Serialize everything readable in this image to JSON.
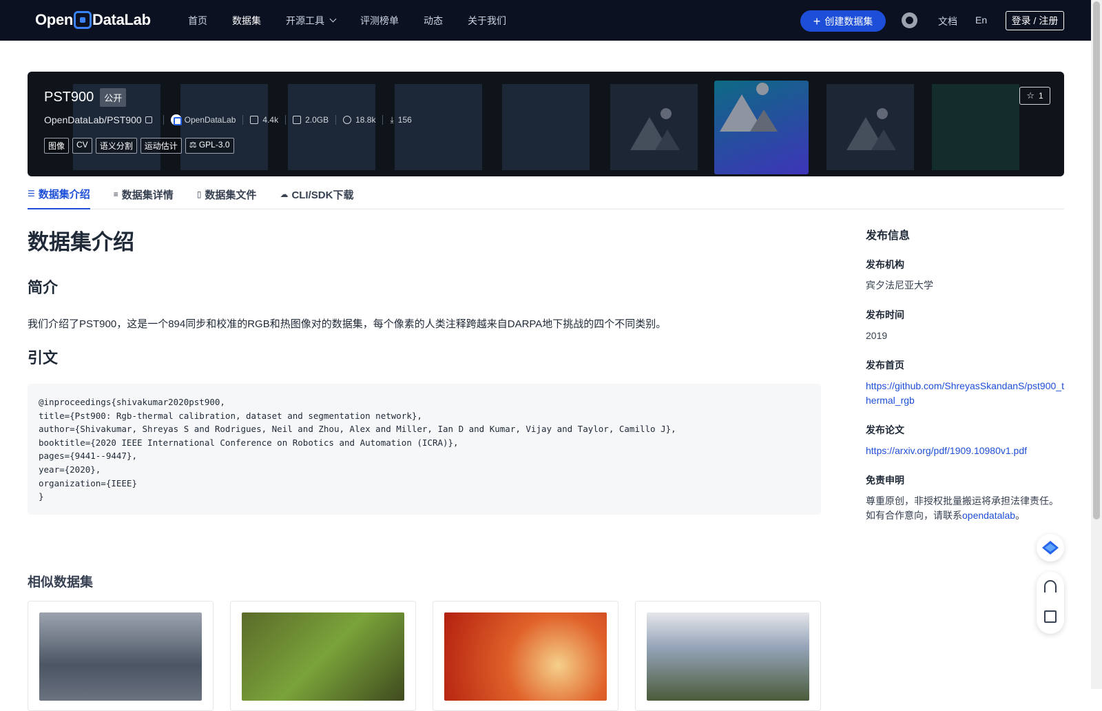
{
  "brand": {
    "name_part1": "Open",
    "name_part2": "DataLab"
  },
  "nav": {
    "home": "首页",
    "datasets": "数据集",
    "tools": "开源工具",
    "leaderboard": "评测榜单",
    "news": "动态",
    "about": "关于我们",
    "create_dataset": "创建数据集",
    "docs": "文档",
    "lang": "En",
    "login": "登录 / 注册"
  },
  "dataset": {
    "name": "PST900",
    "visibility": "公开",
    "path": "OpenDataLab/PST900",
    "org": "OpenDataLab",
    "files": "4.4k",
    "size": "2.0GB",
    "views": "18.8k",
    "downloads": "156",
    "stars": "1",
    "tags": [
      "图像",
      "CV",
      "语义分割",
      "运动估计",
      "GPL-3.0"
    ]
  },
  "tabs": [
    "数据集介绍",
    "数据集详情",
    "数据集文件",
    "CLI/SDK下载"
  ],
  "content": {
    "heading": "数据集介绍",
    "summary_heading": "简介",
    "summary": "我们介绍了PST900，这是一个894同步和校准的RGB和热图像对的数据集，每个像素的人类注释跨越来自DARPA地下挑战的四个不同类别。",
    "citation_heading": "引文",
    "citation": "@inproceedings{shivakumar2020pst900,\ntitle={Pst900: Rgb-thermal calibration, dataset and segmentation network},\nauthor={Shivakumar, Shreyas S and Rodrigues, Neil and Zhou, Alex and Miller, Ian D and Kumar, Vijay and Taylor, Camillo J},\nbooktitle={2020 IEEE International Conference on Robotics and Automation (ICRA)},\npages={9441--9447},\nyear={2020},\norganization={IEEE}\n}",
    "similar_heading": "相似数据集"
  },
  "sidebar": {
    "title": "发布信息",
    "org_label": "发布机构",
    "org_value": "宾夕法尼亚大学",
    "time_label": "发布时间",
    "time_value": "2019",
    "homepage_label": "发布首页",
    "homepage_value": "https://github.com/ShreyasSkandanS/pst900_thermal_rgb",
    "paper_label": "发布论文",
    "paper_value": "https://arxiv.org/pdf/1909.10980v1.pdf",
    "disclaimer_label": "免责申明",
    "disclaimer_line1": "尊重原创，非授权批量搬运将承担法律责任。",
    "disclaimer_line2": "如有合作意向，请联系",
    "disclaimer_link": "opendatalab",
    "disclaimer_end": "。"
  },
  "colors": {
    "accent": "#1d4ed8",
    "topbar": "#0b1120",
    "hero": "#0f141b"
  }
}
